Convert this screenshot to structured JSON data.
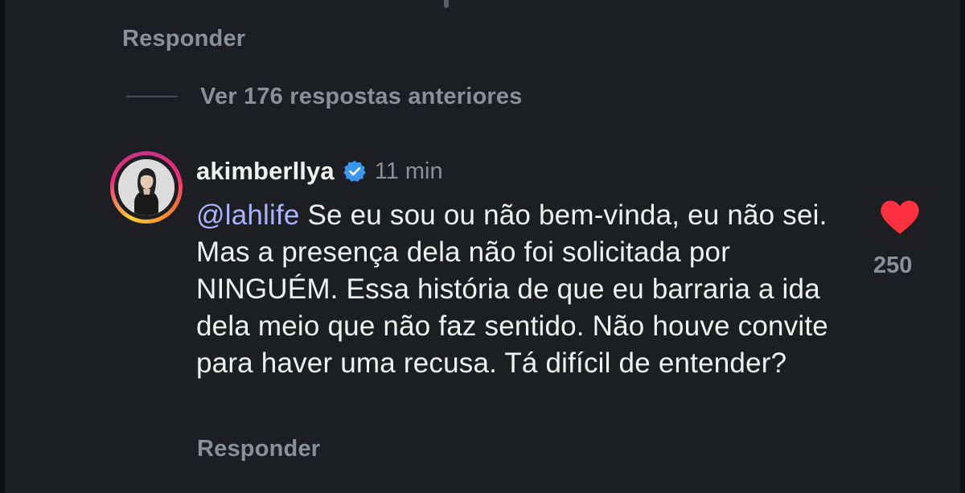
{
  "thread": {
    "reply_label_top": "Responder",
    "view_previous_label": "Ver 176 respostas anteriores"
  },
  "comment": {
    "username": "akimberllya",
    "verified_icon": "verified-badge-icon",
    "time": "11 min",
    "mention": "@lahlife",
    "text": " Se eu sou ou não bem-vinda, eu não sei. Mas a presença dela não foi solicitada por NINGUÉM. Essa história de que eu barraria a ida dela meio que não faz sentido. Não houve convite para haver uma recusa. Tá difícil de entender?",
    "like_icon": "heart-icon",
    "like_count": "250",
    "reply_label": "Responder"
  },
  "colors": {
    "background": "#1c1e22",
    "primary_text": "#f2f2f2",
    "secondary_text": "#8b8f96",
    "mention": "#a8b4ff",
    "heart": "#ff3040",
    "verified": "#3897f0"
  }
}
